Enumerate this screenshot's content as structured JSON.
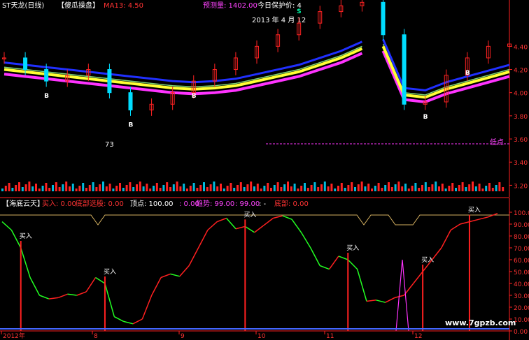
{
  "top_bar": {
    "title": "ST天龙(日线)",
    "template": "【傻瓜操盘】",
    "ma_label": "MA13: 4.50",
    "prediction": "预测量: 1402.00",
    "protect_price": "今日保护价: 4"
  },
  "annotations": {
    "date_label": "2013 年 4 月 12",
    "low_label": "低点",
    "value_73": "73",
    "watermark": "www.7gpzb.com"
  },
  "indicator_header": {
    "name": "【海底云天】",
    "buy": "买入: 0.00",
    "bottom_select": "底部选股: 0.00",
    "top": "顶点: 100.00",
    "sep": ": 0.00",
    "trend": "趋势: 99.00",
    "trend_val": ": 99.00",
    "dash": ": -",
    "bottom": "底部: 0.00"
  },
  "signal_labels": {
    "buy": "买入",
    "b": "B",
    "s": "S"
  },
  "price_axis_labels": [
    "4.40",
    "4.20",
    "4.00",
    "3.80",
    "3.60",
    "3.40",
    "3.20"
  ],
  "indicator_axis_labels": [
    "100.00",
    "90.00",
    "80.00",
    "70.00",
    "60.00",
    "50.00",
    "40.00",
    "30.00",
    "20.00",
    "10.00",
    "0.00"
  ],
  "month_labels": [
    "2012年",
    "8",
    "9",
    "10",
    "11",
    "12"
  ],
  "colors": {
    "up": "#ff2222",
    "down": "#00ddff",
    "ma": "#7ad37a",
    "yellow": "#ffff33",
    "magenta": "#ff33ff",
    "blue": "#2030ff",
    "bar_red": "#ff2020",
    "bar_green": "#22ff22",
    "axis": "#ff2020"
  },
  "chart_data": [
    {
      "type": "line",
      "title": "ST天龙(日线)",
      "xlabel": "",
      "ylabel": "",
      "ylim": [
        3.1,
        4.8
      ],
      "y_ticks": [
        4.4,
        4.2,
        4.0,
        3.8,
        3.6,
        3.4,
        3.2
      ],
      "x_ticks": [
        "2012年",
        "8",
        "9",
        "10",
        "11",
        "12"
      ],
      "series": [
        {
          "name": "MA13",
          "values": [
            4.22,
            4.2,
            4.18,
            4.16,
            4.14,
            4.12,
            4.1,
            4.08,
            4.06,
            4.05,
            4.06,
            4.08,
            4.12,
            4.16,
            4.2,
            4.26,
            4.32,
            4.4,
            4.42,
            4.0,
            3.98,
            4.05,
            4.1,
            4.15,
            4.2
          ]
        }
      ],
      "close": [
        4.3,
        4.2,
        4.1,
        4.15,
        4.2,
        4.0,
        3.85,
        3.9,
        4.0,
        4.1,
        4.2,
        4.3,
        4.4,
        4.5,
        4.6,
        4.7,
        4.75,
        4.78,
        4.5,
        3.9,
        3.92,
        4.15,
        4.3,
        4.4,
        4.42
      ],
      "gaps_after_index": [
        17
      ]
    },
    {
      "type": "line",
      "title": "【海底云天】",
      "xlabel": "",
      "ylabel": "",
      "ylim": [
        0,
        100
      ],
      "y_ticks": [
        100,
        90,
        80,
        70,
        60,
        50,
        40,
        30,
        20,
        10,
        0
      ],
      "series": [
        {
          "name": "趋势",
          "values": [
            92,
            85,
            70,
            45,
            30,
            27,
            28,
            31,
            30,
            33,
            45,
            40,
            12,
            8,
            6,
            10,
            30,
            45,
            48,
            46,
            55,
            70,
            85,
            92,
            95,
            86,
            88,
            83,
            89,
            95,
            97,
            94,
            83,
            70,
            55,
            52,
            63,
            60,
            52,
            25,
            26,
            24,
            28,
            30,
            40,
            50,
            60,
            70,
            85,
            90,
            92,
            94,
            96,
            99
          ]
        }
      ],
      "buy_signals_x_index": [
        2,
        11,
        26,
        37,
        45,
        50
      ],
      "purple_spike_peak": 60
    }
  ]
}
